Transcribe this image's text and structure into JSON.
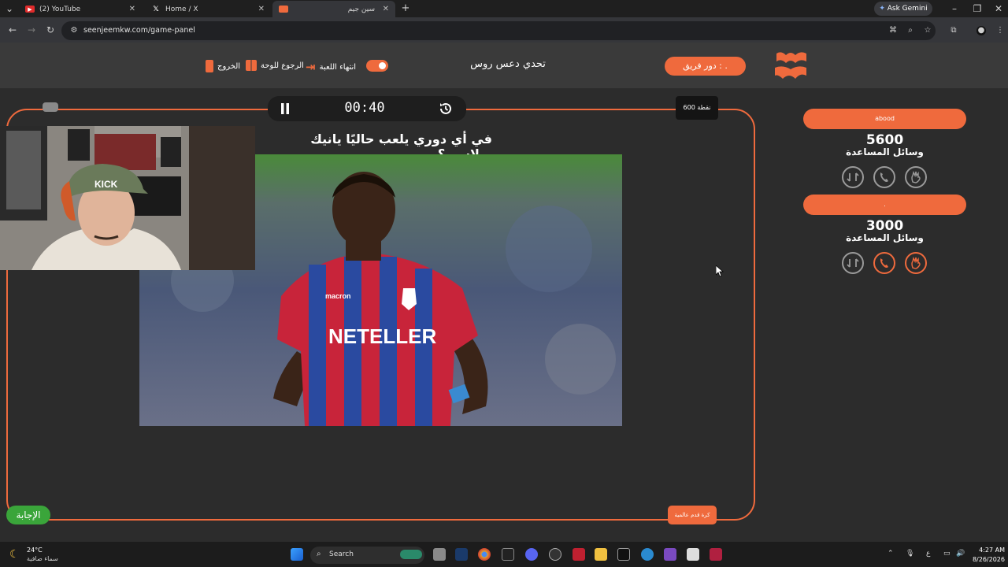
{
  "browser": {
    "tabs": [
      {
        "label": "(2) YouTube",
        "active": false
      },
      {
        "label": "Home / X",
        "active": false
      },
      {
        "label": "سين جيم",
        "active": true
      }
    ],
    "new_tab": "+",
    "ask_gemini": "Ask Gemini",
    "url": "seenjeemkw.com/game-panel"
  },
  "header": {
    "exit_label": "الخروج",
    "back_to_board_label": "الرجوع للوحة",
    "end_game_label": "انتهاء اللعبة",
    "challenge_title": "تحدي دعس روس",
    "turn_label": "دور فريق : .",
    "logo_text": "سين جيم"
  },
  "game": {
    "timer": "00:40",
    "points_badge": "600 نقطة",
    "question": "في أي دوري يلعب حاليًا يانيك بولاسي؟",
    "jersey_text": "NETELLER",
    "jersey_brand": "macron",
    "answer_button": "الإجابة",
    "hint_button": "كرة قدم عالمية"
  },
  "webcam": {
    "cap_text": "KICK"
  },
  "teams": [
    {
      "name": "abood",
      "score": "5600",
      "aids_label": "وسائل المساعدة",
      "aids": [
        {
          "icon": "swap-icon",
          "active": false
        },
        {
          "icon": "phone-icon",
          "active": false
        },
        {
          "icon": "hand-icon",
          "active": false
        }
      ]
    },
    {
      "name": ".",
      "score": "3000",
      "aids_label": "وسائل المساعدة",
      "aids": [
        {
          "icon": "swap-icon",
          "active": false
        },
        {
          "icon": "phone-icon",
          "active": true
        },
        {
          "icon": "hand-icon",
          "active": true
        }
      ]
    }
  ],
  "taskbar": {
    "temperature": "24°C",
    "weather": "سماء صافية",
    "search_label": "Search",
    "time": "4:27 AM",
    "date": "8/26/2026",
    "lang": "ع"
  },
  "colors": {
    "accent": "#ef6a3d",
    "answer": "#3aa53a",
    "background": "#2c2c2c"
  }
}
